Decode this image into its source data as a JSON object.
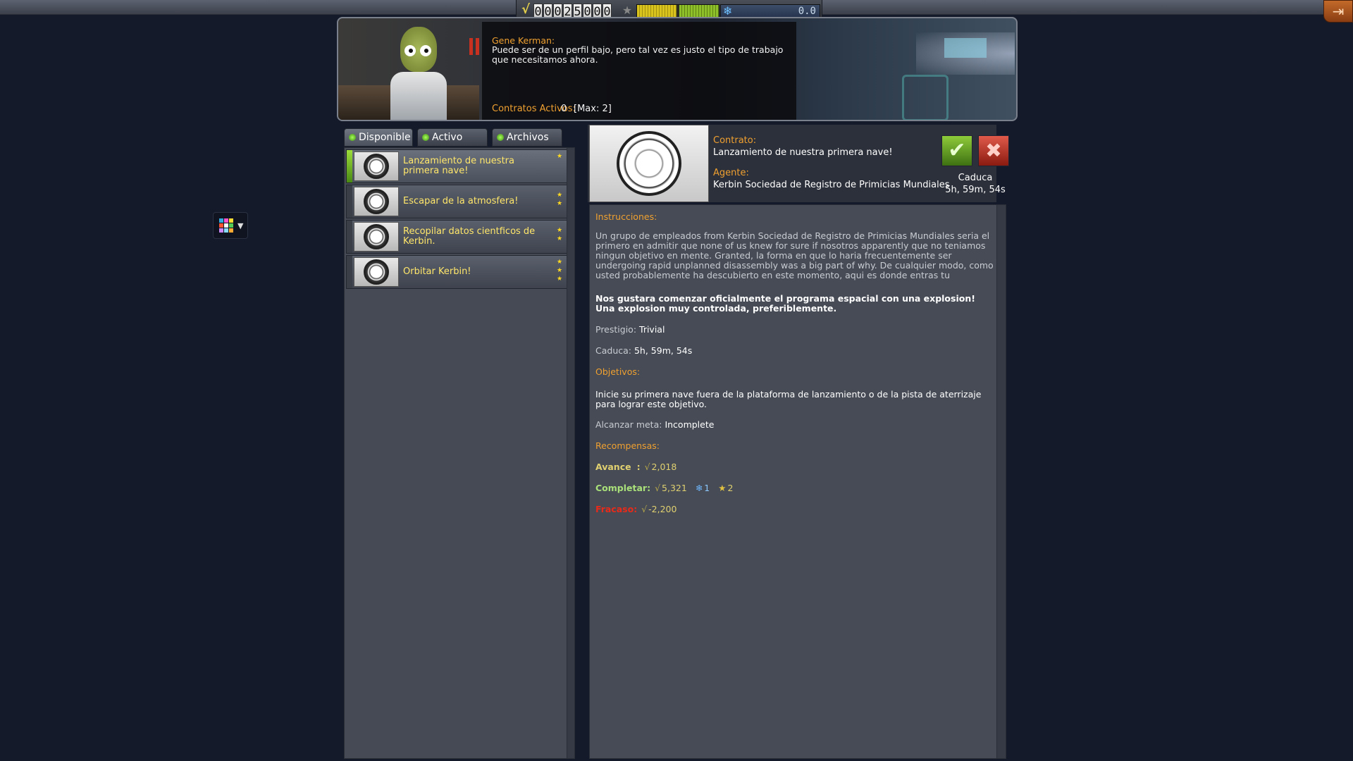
{
  "hud": {
    "funds_digits": [
      "0",
      "0",
      "0",
      "2",
      "5",
      "0",
      "0",
      "0"
    ],
    "science_value": "0.0",
    "reputation_fraction": 0.5
  },
  "window": {
    "dialog": {
      "speaker": "Gene Kerman:",
      "message": "Puede ser de un perfil bajo, pero tal vez es justo el tipo de trabajo que necesitamos ahora.",
      "active_label": "Contratos Activos:",
      "active_value": "0",
      "active_max": "[Max: 2]"
    },
    "tabs": [
      {
        "label": "Disponible"
      },
      {
        "label": "Activo"
      },
      {
        "label": "Archivos"
      }
    ],
    "contracts": [
      {
        "title": "Lanzamiento de nuestra primera nave!",
        "stars": 1
      },
      {
        "title": "Escapar de la atmosfera!",
        "stars": 2
      },
      {
        "title": "Recopilar datos cientficos de Kerbin.",
        "stars": 2
      },
      {
        "title": "Orbitar Kerbin!",
        "stars": 3
      }
    ],
    "detail": {
      "contract_label": "Contrato:",
      "contract_title": "Lanzamiento de nuestra primera nave!",
      "agent_label": "Agente:",
      "agent_name": "Kerbin Sociedad de Registro de Primicias Mundiales",
      "expire_label": "Caduca",
      "expire_value": "5h, 59m, 54s",
      "instructions_label": "Instrucciones:",
      "description": "Un grupo de empleados from Kerbin Sociedad de Registro de Primicias Mundiales seria el primero en admitir que none of us knew for sure if nosotros apparently que no teniamos ningun objetivo en mente. Granted, la forma en que lo haria frecuentemente ser undergoing rapid unplanned disassembly was a big part of why. De cualquier modo, como usted probablemente ha descubierto en este momento, aqui es donde entras tu",
      "synopsis": "Nos gustara comenzar oficialmente el programa espacial con una explosion! Una explosion muy controlada, preferiblemente.",
      "prestige_label": "Prestigio:",
      "prestige_value": "Trivial",
      "deadline_label": "Caduca:",
      "deadline_value": "5h, 59m, 54s",
      "objectives_label": "Objetivos:",
      "objective_text": "Inicie su primera nave fuera de la plataforma de lanzamiento o de la pista de aterrizaje para lograr este objetivo.",
      "goal_label": "Alcanzar meta:",
      "goal_value": "Incomplete",
      "rewards_label": "Recompensas:",
      "advance_label": "Avance",
      "advance_colon": ":",
      "advance_funds": "2,018",
      "complete_label": "Completar:",
      "complete_funds": "5,321",
      "complete_science": "1",
      "complete_reputation": "2",
      "failure_label": "Fracaso:",
      "failure_funds": "-2,200"
    }
  },
  "colors": {
    "accent_orange": "#f0a030",
    "contract_title_yellow": "#ffe66a",
    "complete_green": "#a9e07a",
    "failure_red": "#e82a1a",
    "accept_green": "#6aa828",
    "decline_red": "#c03020"
  }
}
